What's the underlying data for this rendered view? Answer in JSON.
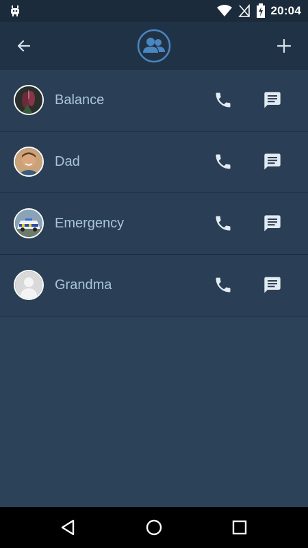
{
  "status_bar": {
    "time": "20:04",
    "icons": [
      "android-debug-icon",
      "wifi-icon",
      "no-signal-icon",
      "battery-charging-icon"
    ]
  },
  "app_bar": {
    "back_icon": "arrow-left-icon",
    "logo_icon": "contacts-group-icon",
    "add_icon": "plus-icon"
  },
  "contacts": [
    {
      "name": "Balance",
      "avatar": "photo-balance"
    },
    {
      "name": "Dad",
      "avatar": "photo-dad"
    },
    {
      "name": "Emergency",
      "avatar": "photo-emergency"
    },
    {
      "name": "Grandma",
      "avatar": "placeholder-person"
    }
  ],
  "colors": {
    "background": "#2b4259",
    "appbar": "#203346",
    "statusbar": "#1b2b3b",
    "name_text": "#a9c3dc",
    "accent_icon": "#4a86c0"
  },
  "nav_bar": {
    "icons": [
      "nav-back-icon",
      "nav-home-icon",
      "nav-recents-icon"
    ]
  }
}
